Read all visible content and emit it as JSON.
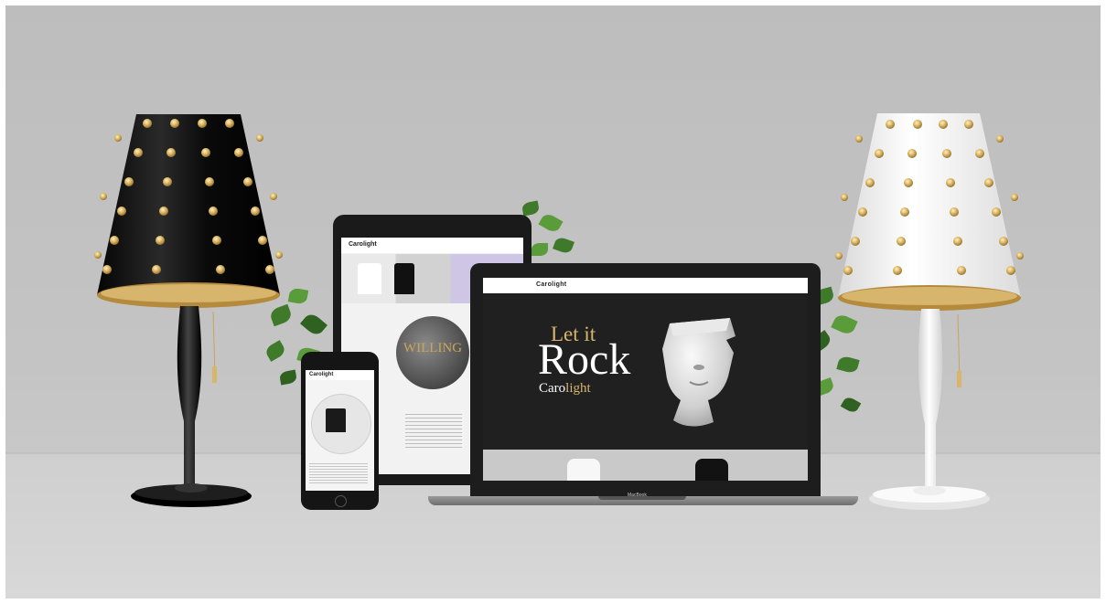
{
  "scene": {
    "description_colors": {
      "wall": "#c2c2c2",
      "floor": "#d4d4d4",
      "gold": "#d7b56d",
      "black": "#111111",
      "white": "#f7f7f7"
    }
  },
  "laptop": {
    "logo": "Carolight",
    "headline_line1": "Let it",
    "headline_line2": "Rock",
    "brand_prefix": "Caro",
    "brand_suffix": "light",
    "base_label": "MacBook"
  },
  "tablet": {
    "logo": "Carolight",
    "circle_text": "WILLING"
  },
  "phone": {
    "logo": "Carolight"
  }
}
